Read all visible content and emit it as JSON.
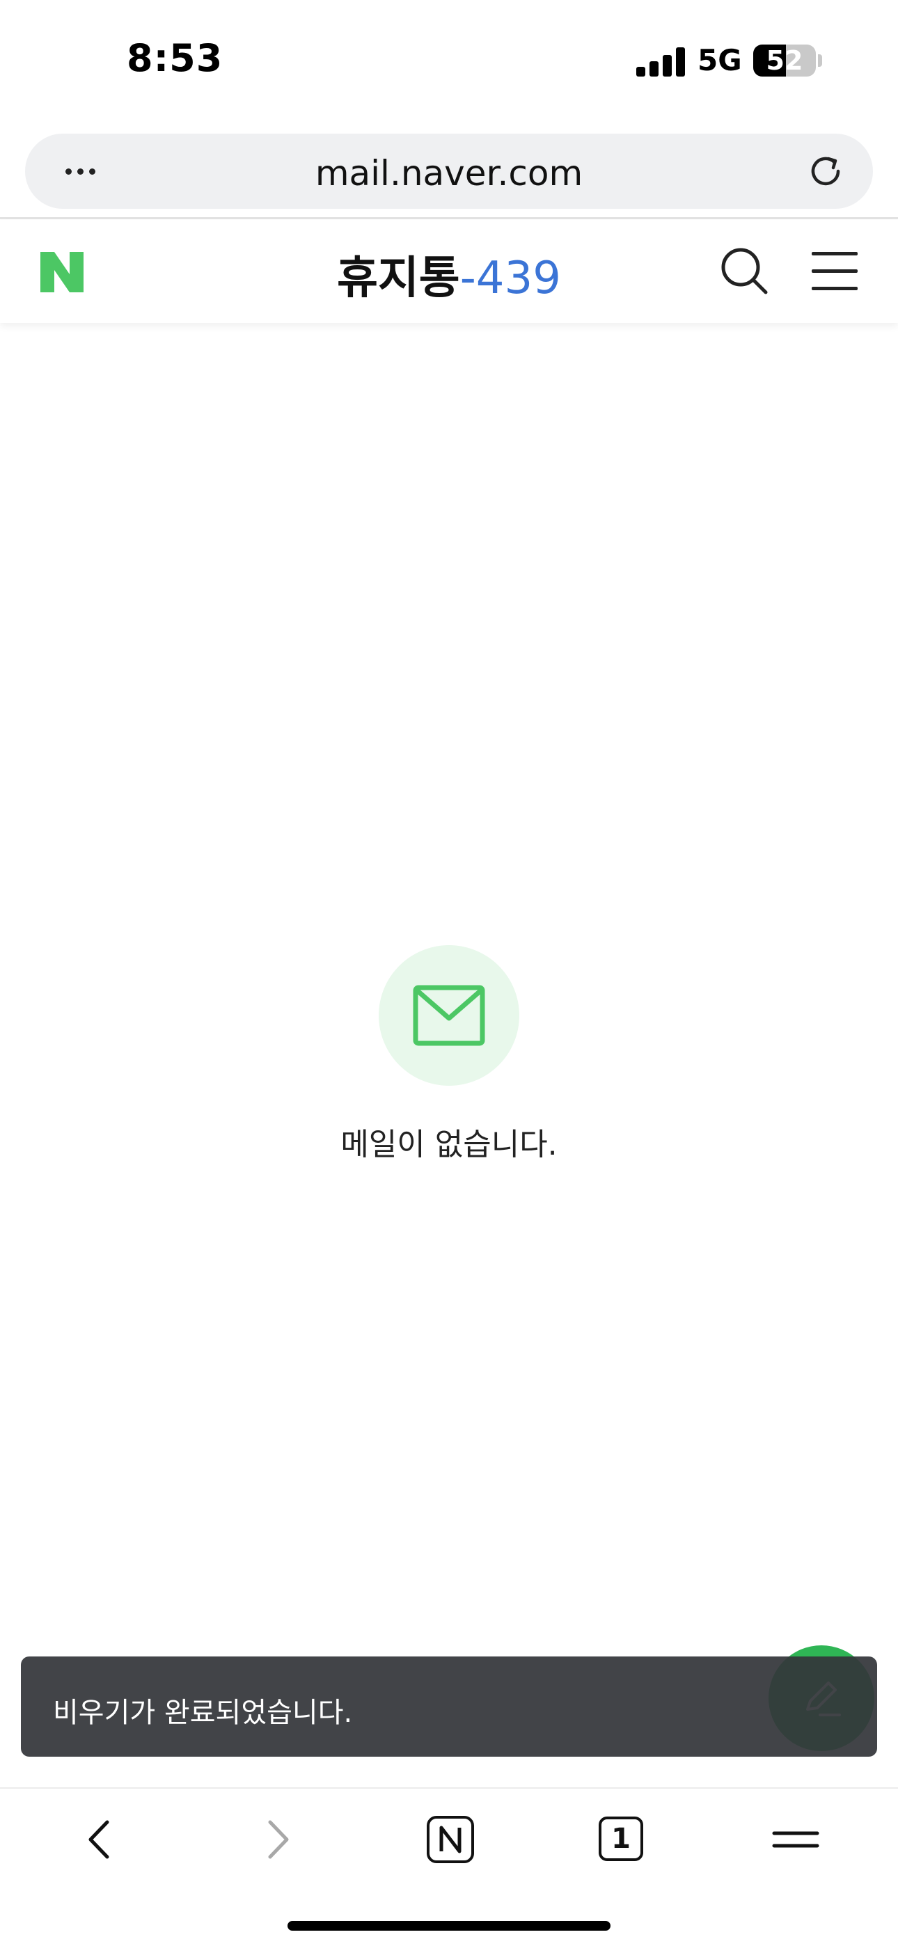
{
  "status_bar": {
    "time": "8:53",
    "network": "5G",
    "battery_level": "52"
  },
  "browser": {
    "url": "mail.naver.com",
    "more_icon": "ellipsis-icon",
    "reload_icon": "reload-icon",
    "tab_count": "1"
  },
  "header": {
    "folder_title": "휴지통",
    "count": "-439",
    "logo": "naver-n-logo",
    "search_icon": "search-icon",
    "menu_icon": "hamburger-icon"
  },
  "empty_state": {
    "icon": "envelope-icon",
    "message": "메일이 없습니다."
  },
  "toast": {
    "message": "비우기가 완료되었습니다."
  },
  "fab": {
    "icon": "compose-pencil-icon"
  },
  "bottom_bar": {
    "items": [
      "back-icon",
      "forward-icon",
      "naver-home-icon",
      "tabs-icon",
      "menu-icon"
    ]
  },
  "colors": {
    "naver_green": "#03C75A",
    "logo_green": "#4cc764",
    "count_blue": "#3b74d6",
    "toast_bg": "#34363a",
    "empty_circle": "#e8f8eb"
  }
}
